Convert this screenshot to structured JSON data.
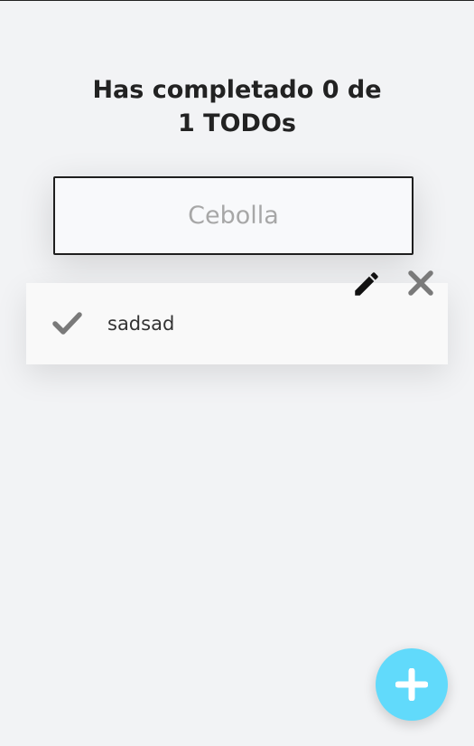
{
  "counter": {
    "line1": "Has completado 0 de",
    "line2": "1 TODOs"
  },
  "search": {
    "placeholder": "Cebolla"
  },
  "todos": [
    {
      "text": "sadsad",
      "completed": false,
      "check_icon": "check-icon",
      "edit_icon": "pencil-icon",
      "delete_icon": "close-icon"
    }
  ],
  "fab": {
    "icon": "plus-icon",
    "color": "#61dafb"
  },
  "colors": {
    "background": "#f2f3f5",
    "card": "#f9f9f9",
    "text": "#222222",
    "icon_gray": "#7a7a7a",
    "accent": "#61dafb"
  }
}
